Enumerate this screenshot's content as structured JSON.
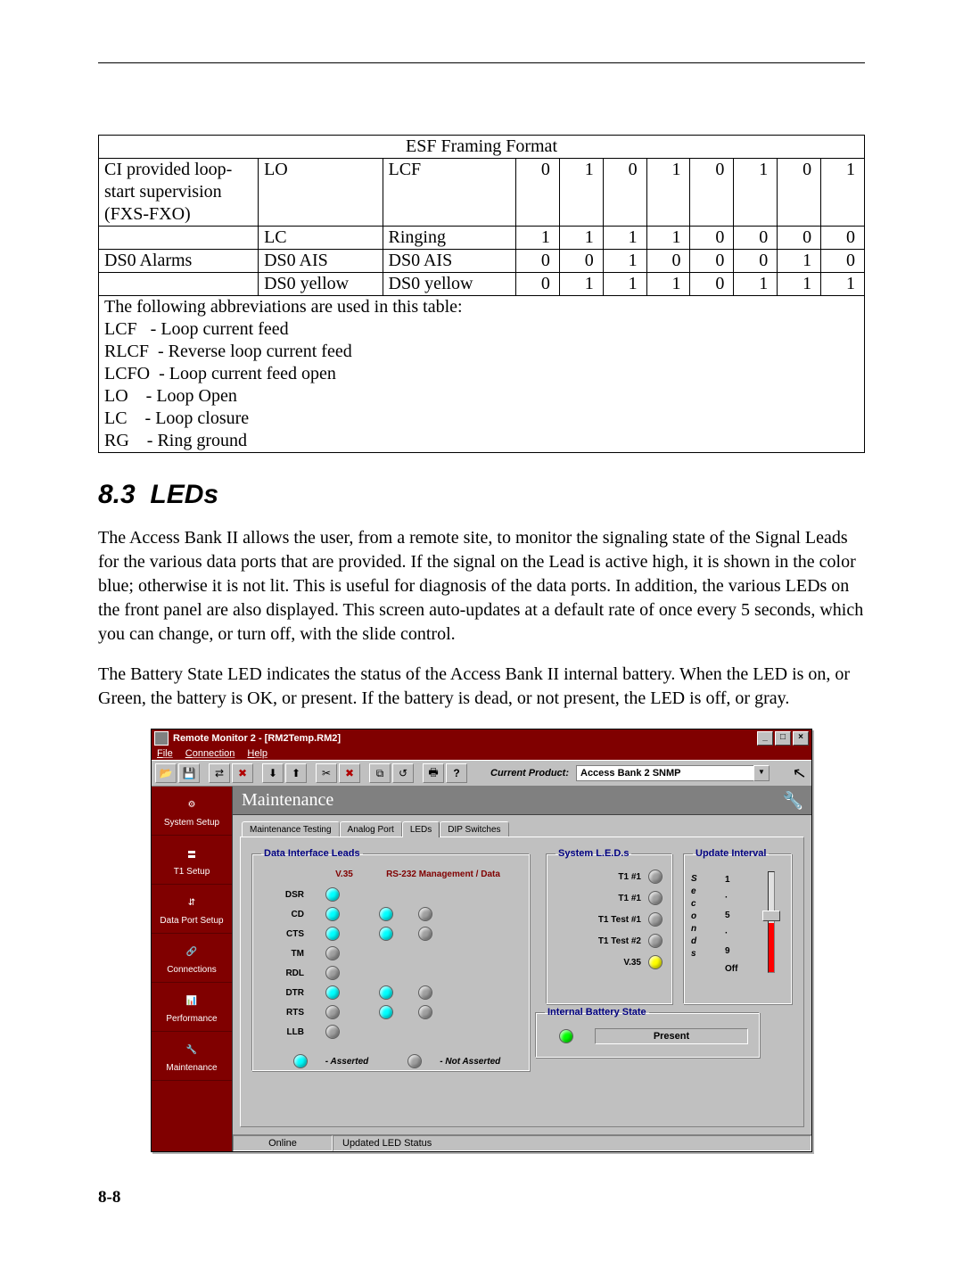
{
  "table": {
    "title": "ESF Framing Format",
    "rows": [
      {
        "c1_lines": [
          "CI provided loop-",
          "start supervision",
          "(FXS-FXO)"
        ],
        "c2": "LO",
        "c3": "LCF",
        "bits": [
          "0",
          "1",
          "0",
          "1",
          "0",
          "1",
          "0",
          "1"
        ]
      },
      {
        "c1_lines": [
          ""
        ],
        "c2": "LC",
        "c3": "Ringing",
        "bits": [
          "1",
          "1",
          "1",
          "1",
          "0",
          "0",
          "0",
          "0"
        ]
      },
      {
        "c1_lines": [
          "DS0 Alarms"
        ],
        "c2": "DS0 AIS",
        "c3": "DS0 AIS",
        "bits": [
          "0",
          "0",
          "1",
          "0",
          "0",
          "0",
          "1",
          "0"
        ]
      },
      {
        "c1_lines": [
          ""
        ],
        "c2": "DS0 yellow",
        "c3": "DS0 yellow",
        "bits": [
          "0",
          "1",
          "1",
          "1",
          "0",
          "1",
          "1",
          "1"
        ]
      }
    ],
    "footer_lines": [
      "The following abbreviations are used in this table:",
      "LCF   - Loop current feed",
      "RLCF  - Reverse loop current feed",
      "LCFO  - Loop current feed open",
      "LO    - Loop Open",
      "LC    - Loop closure",
      "RG    - Ring ground"
    ]
  },
  "section": {
    "number": "8.3",
    "title": "LEDs",
    "para1": "The Access Bank II allows the user, from a remote site, to monitor the signaling state of the Signal Leads for the various data ports that are provided. If the signal on the Lead is active high, it is shown in the color blue; otherwise it is not lit. This is useful for diagnosis of the data ports. In addition, the various LEDs on the front panel are also displayed. This screen auto-updates at a default rate of once every 5 seconds, which you can change, or turn off, with the slide control.",
    "para2": "The Battery State LED indicates the status of the Access Bank II internal battery. When the LED is on, or Green, the battery is OK, or present. If the battery is dead, or not present, the LED is off, or gray."
  },
  "app": {
    "title": "Remote Monitor 2 - [RM2Temp.RM2]",
    "menus": {
      "file": "File",
      "connection": "Connection",
      "help": "Help"
    },
    "toolbar": {
      "product_label": "Current Product:",
      "product_value": "Access Bank 2 SNMP"
    },
    "section_title": "Maintenance",
    "sidebar": [
      {
        "label": "System Setup"
      },
      {
        "label": "T1 Setup"
      },
      {
        "label": "Data Port Setup"
      },
      {
        "label": "Connections"
      },
      {
        "label": "Performance"
      },
      {
        "label": "Maintenance"
      }
    ],
    "tabs": [
      {
        "label": "Maintenance Testing",
        "active": false
      },
      {
        "label": "Analog Port",
        "active": false
      },
      {
        "label": "LEDs",
        "active": true
      },
      {
        "label": "DIP Switches",
        "active": false
      }
    ],
    "leads": {
      "legend": "Data Interface Leads",
      "col_v35": "V.35",
      "col_rs": "RS-232 Management / Data",
      "rows": [
        {
          "name": "DSR",
          "v35": "on",
          "rs1": null,
          "rs2": null
        },
        {
          "name": "CD",
          "v35": "on",
          "rs1": "on",
          "rs2": "off"
        },
        {
          "name": "CTS",
          "v35": "on",
          "rs1": "on",
          "rs2": "off"
        },
        {
          "name": "TM",
          "v35": "off",
          "rs1": null,
          "rs2": null
        },
        {
          "name": "RDL",
          "v35": "off",
          "rs1": null,
          "rs2": null
        },
        {
          "name": "DTR",
          "v35": "on",
          "rs1": "on",
          "rs2": "off"
        },
        {
          "name": "RTS",
          "v35": "off",
          "rs1": "on",
          "rs2": "off"
        },
        {
          "name": "LLB",
          "v35": "off",
          "rs1": null,
          "rs2": null
        }
      ],
      "legend_on": "- Asserted",
      "legend_off": "- Not Asserted"
    },
    "system_leds": {
      "legend": "System L.E.D.s",
      "rows": [
        {
          "name": "T1 #1",
          "state": "off"
        },
        {
          "name": "T1 #1",
          "state": "off"
        },
        {
          "name": "T1 Test #1",
          "state": "off"
        },
        {
          "name": "T1 Test #2",
          "state": "off"
        },
        {
          "name": "V.35",
          "state": "yellow"
        }
      ]
    },
    "interval": {
      "legend": "Update Interval",
      "scale_word": "Seconds",
      "ticks": [
        "1",
        "5",
        "9"
      ],
      "off_label": "Off"
    },
    "battery": {
      "legend": "Internal Battery State",
      "value": "Present",
      "state": "green"
    },
    "statusbar": {
      "left": "Online",
      "right": "Updated LED Status"
    },
    "page_number": "8-8"
  }
}
